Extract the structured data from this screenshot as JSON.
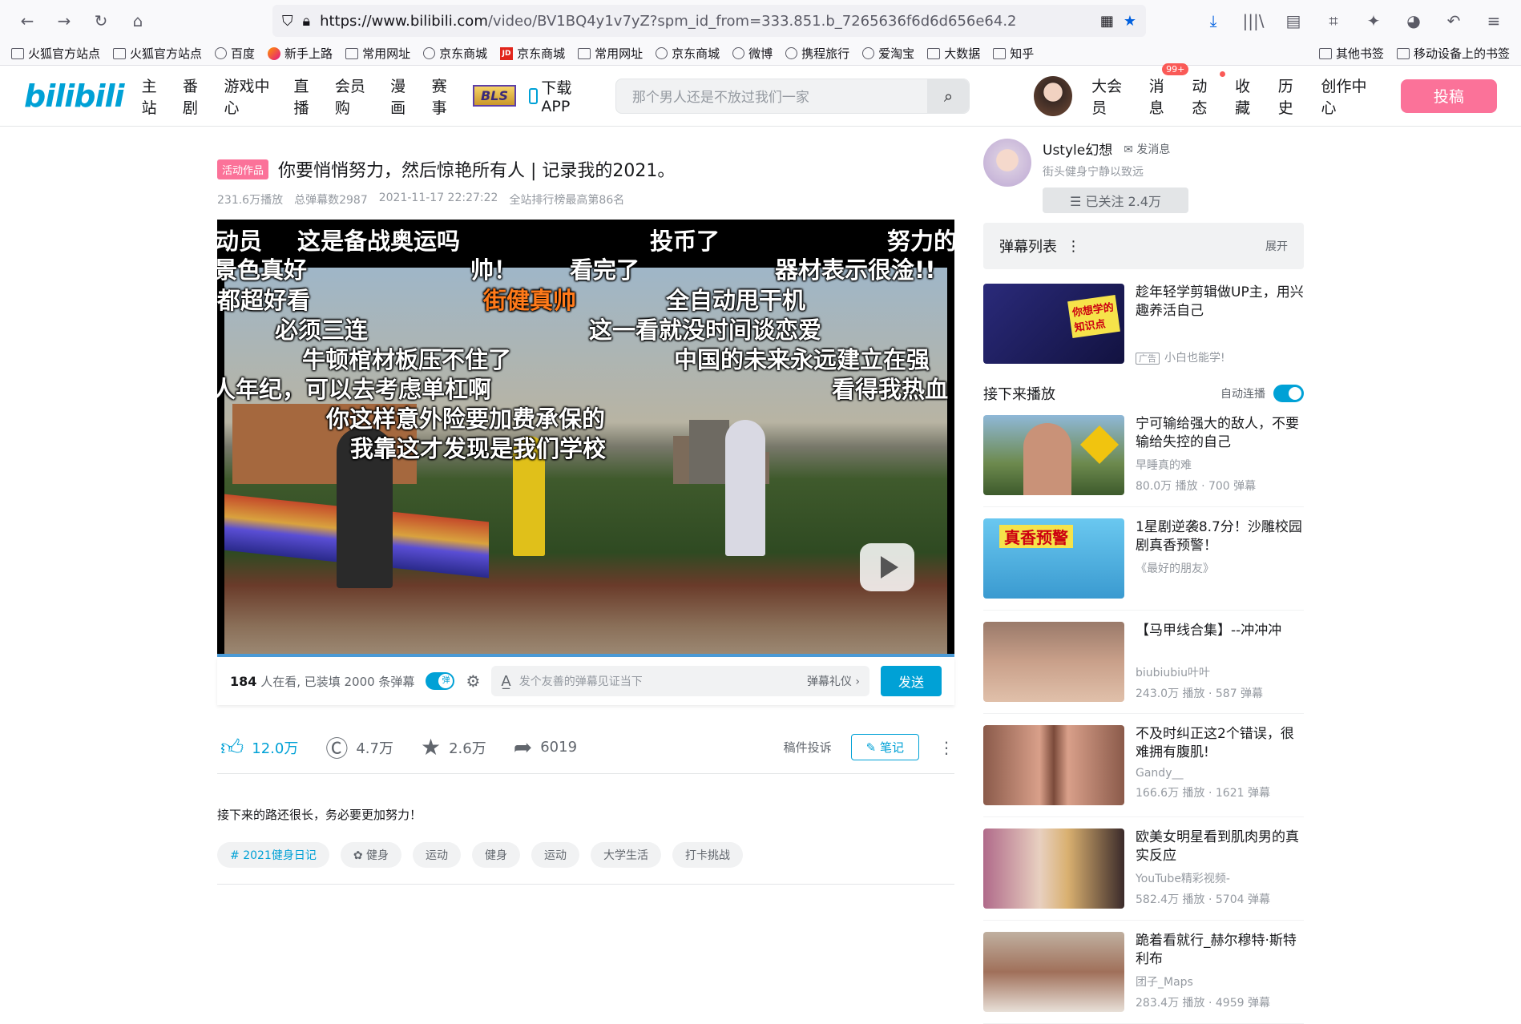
{
  "browser": {
    "url_prefix": "https://www.bilibili.com",
    "url_path": "/video/BV1BQ4y1v7yZ?spm_id_from=333.851.b_7265636f6d6d656e64.2",
    "bookmarks": [
      "火狐官方站点",
      "火狐官方站点",
      "百度",
      "新手上路",
      "常用网址",
      "京东商城",
      "京东商城",
      "常用网址",
      "京东商城",
      "微博",
      "携程旅行",
      "爱淘宝",
      "大数据",
      "知乎"
    ],
    "bookmarks_right": [
      "其他书签",
      "移动设备上的书签"
    ]
  },
  "header": {
    "logo": "bilibili",
    "nav": [
      "主站",
      "番剧",
      "游戏中心",
      "直播",
      "会员购",
      "漫画",
      "赛事"
    ],
    "bls": "BLS",
    "app": "下载APP",
    "search_placeholder": "那个男人还是不放过我们一家",
    "user_nav": [
      "大会员",
      "消息",
      "动态",
      "收藏",
      "历史",
      "创作中心"
    ],
    "msg_badge": "99+",
    "upload": "投稿"
  },
  "video": {
    "tag": "活动作品",
    "title": "你要悄悄努力，然后惊艳所有人 | 记录我的2021。",
    "plays": "231.6万播放",
    "danmaku_total": "总弹幕数2987",
    "date": "2021-11-17 22:27:22",
    "rank": "全站排行榜最高第86名",
    "danmaku": [
      "动员",
      "这是备战奥运吗",
      "投币了",
      "努力的",
      "景色真好",
      "帅！",
      "看完了",
      "器材表示很淦!!",
      "都超好看",
      "街健真帅",
      "全自动甩干机",
      "必须三连",
      "这一看就没时间谈恋爱",
      "牛顿棺材板压不住了",
      "中国的未来永远建立在强",
      "人年纪，可以去考虑单杠啊",
      "看得我热血",
      "你这样意外险要加费承保的",
      "我靠这才发现是我们学校"
    ],
    "watching": "184",
    "watching_text": "人在看, 已装填 2000 条弹幕",
    "dm_placeholder": "发个友善的弹幕见证当下",
    "dm_etiquette": "弹幕礼仪 ›",
    "send": "发送",
    "like": "12.0万",
    "coin": "4.7万",
    "fav": "2.6万",
    "share": "6019",
    "report": "稿件投诉",
    "note": "笔记",
    "desc": "接下来的路还很长，务必要更加努力！",
    "tags": [
      "2021健身日记",
      "健身",
      "运动",
      "健身",
      "运动",
      "大学生活",
      "打卡挑战"
    ]
  },
  "up": {
    "name": "Ustyle幻想",
    "msg": "发消息",
    "sign": "街头健身宁静以致远",
    "follow": "☰ 已关注 2.4万"
  },
  "danmaku_list": {
    "label": "弹幕列表",
    "expand": "展开"
  },
  "ad": {
    "title": "趁年轻学剪辑做UP主，用兴趣养活自己",
    "tag": "广告",
    "source": "小白也能学!"
  },
  "next": {
    "label": "接下来播放",
    "autoplay": "自动连播"
  },
  "recs": [
    {
      "title": "宁可输给强大的敌人，不要输给失控的自己",
      "author": "早睡真的难",
      "stats": "80.0万 播放 · 700 弹幕"
    },
    {
      "title": "1星剧逆袭8.7分！沙雕校园剧真香预警！",
      "author": "《最好的朋友》",
      "stats": ""
    },
    {
      "title": "【马甲线合集】--冲冲冲",
      "author": "biubiubiu叶叶",
      "stats": "243.0万 播放 · 587 弹幕"
    },
    {
      "title": "不及时纠正这2个错误，很难拥有腹肌!",
      "author": "Gandy__",
      "stats": "166.6万 播放 · 1621 弹幕"
    },
    {
      "title": "欧美女明星看到肌肉男的真实反应",
      "author": "YouTube精彩视频-",
      "stats": "582.4万 播放 · 5704 弹幕"
    },
    {
      "title": "跪着看就行_赫尔穆特·斯特利布",
      "author": "团子_Maps",
      "stats": "283.4万 播放 · 4959 弹幕"
    }
  ]
}
